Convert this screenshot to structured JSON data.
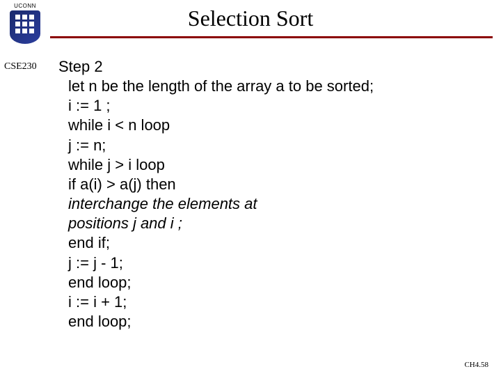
{
  "header": {
    "uconn_label": "UCONN",
    "title": "Selection Sort"
  },
  "course_code": "CSE230",
  "content": {
    "step_label": "Step 2",
    "lines": {
      "l1": "let n be the length of the array a to be sorted;",
      "l2": "i := 1 ;",
      "l3": "while i < n loop",
      "l4": "j := n;",
      "l5": "while j > i loop",
      "l6": "if a(i) > a(j) then",
      "l7": "interchange the elements at",
      "l8": "positions j and i ;",
      "l9": "end if;",
      "l10": "j := j - 1;",
      "l11": "end loop;",
      "l12": "i := i + 1;",
      "l13": "end loop;"
    }
  },
  "footer": "CH4.58"
}
